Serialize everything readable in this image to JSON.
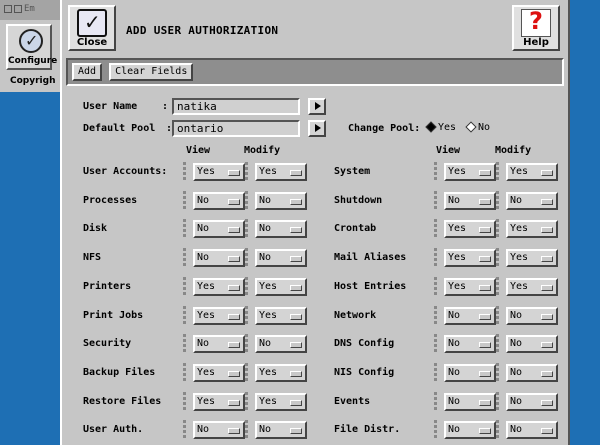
{
  "background_window": {
    "titlebar_text": "Em",
    "configure_label": "Configure",
    "copyright_text": "Copyrigh"
  },
  "dialog": {
    "title": "ADD USER AUTHORIZATION",
    "close_label": "Close",
    "help_label": "Help"
  },
  "toolbar": {
    "add_label": "Add",
    "clear_label": "Clear Fields"
  },
  "form": {
    "user_name_label": "User Name",
    "user_name_value": "natika",
    "default_pool_label": "Default Pool",
    "default_pool_value": "ontario",
    "change_pool_label": "Change Pool:",
    "change_pool_yes": "Yes",
    "change_pool_no": "No",
    "change_pool_selected": "Yes",
    "colon": ":"
  },
  "columns": {
    "view": "View",
    "modify": "Modify"
  },
  "left_rows": [
    {
      "label": "User Accounts:",
      "view": "Yes",
      "modify": "Yes"
    },
    {
      "label": "Processes",
      "view": "No",
      "modify": "No"
    },
    {
      "label": "Disk",
      "view": "No",
      "modify": "No"
    },
    {
      "label": "NFS",
      "view": "No",
      "modify": "No"
    },
    {
      "label": "Printers",
      "view": "Yes",
      "modify": "Yes"
    },
    {
      "label": "Print Jobs",
      "view": "Yes",
      "modify": "Yes"
    },
    {
      "label": "Security",
      "view": "No",
      "modify": "No"
    },
    {
      "label": "Backup Files",
      "view": "Yes",
      "modify": "Yes"
    },
    {
      "label": "Restore Files",
      "view": "Yes",
      "modify": "Yes"
    },
    {
      "label": "User Auth.",
      "view": "No",
      "modify": "No"
    }
  ],
  "right_rows": [
    {
      "label": "System",
      "view": "Yes",
      "modify": "Yes"
    },
    {
      "label": "Shutdown",
      "view": "No",
      "modify": "No"
    },
    {
      "label": "Crontab",
      "view": "Yes",
      "modify": "Yes"
    },
    {
      "label": "Mail Aliases",
      "view": "Yes",
      "modify": "Yes"
    },
    {
      "label": "Host Entries",
      "view": "Yes",
      "modify": "Yes"
    },
    {
      "label": "Network",
      "view": "No",
      "modify": "No"
    },
    {
      "label": "DNS Config",
      "view": "No",
      "modify": "No"
    },
    {
      "label": "NIS Config",
      "view": "No",
      "modify": "No"
    },
    {
      "label": "Events",
      "view": "No",
      "modify": "No"
    },
    {
      "label": "File Distr.",
      "view": "No",
      "modify": "No"
    }
  ],
  "colors": {
    "desktop": "#1e6fb4",
    "panel": "#c6c6c6",
    "toolbar": "#8e8e8e"
  }
}
